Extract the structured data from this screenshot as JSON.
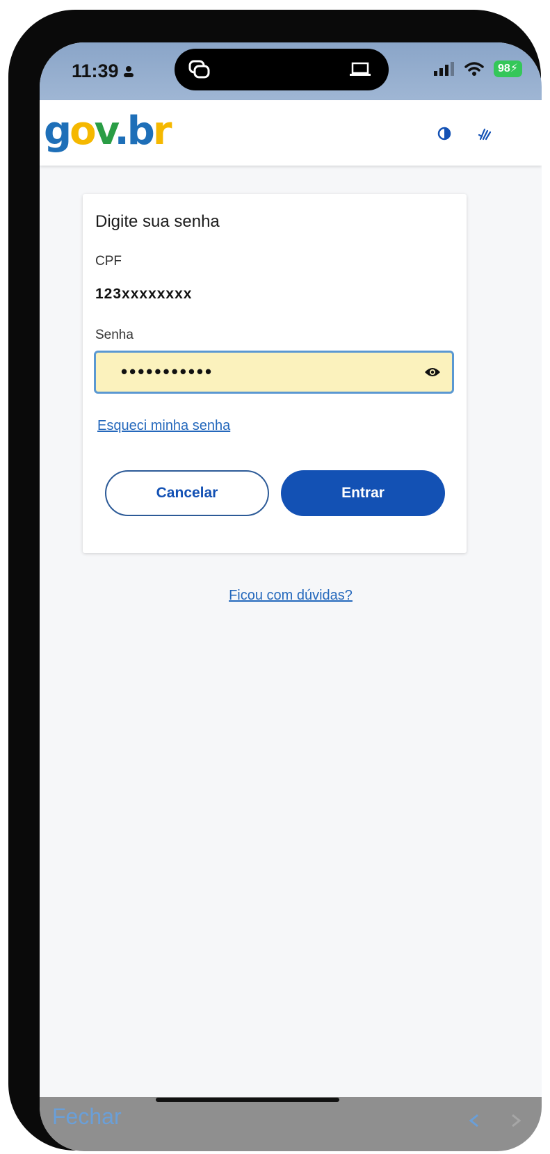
{
  "status_bar": {
    "time": "11:39",
    "battery": "98"
  },
  "header": {
    "logo": {
      "g": "g",
      "o": "o",
      "v": "v",
      "dot": ".",
      "b": "b",
      "r": "r"
    }
  },
  "login_card": {
    "title": "Digite sua senha",
    "cpf_label": "CPF",
    "cpf_value": "123xxxxxxxx",
    "password_label": "Senha",
    "password_masked": "•••••••••••",
    "forgot_link": "Esqueci minha senha",
    "cancel_button": "Cancelar",
    "enter_button": "Entrar"
  },
  "help_link": "Ficou com dúvidas?",
  "browser_bar": {
    "close_label": "Fechar"
  },
  "colors": {
    "primary_blue": "#1351b4",
    "field_highlight": "#fbf2bd",
    "link_blue": "#2468bc"
  }
}
